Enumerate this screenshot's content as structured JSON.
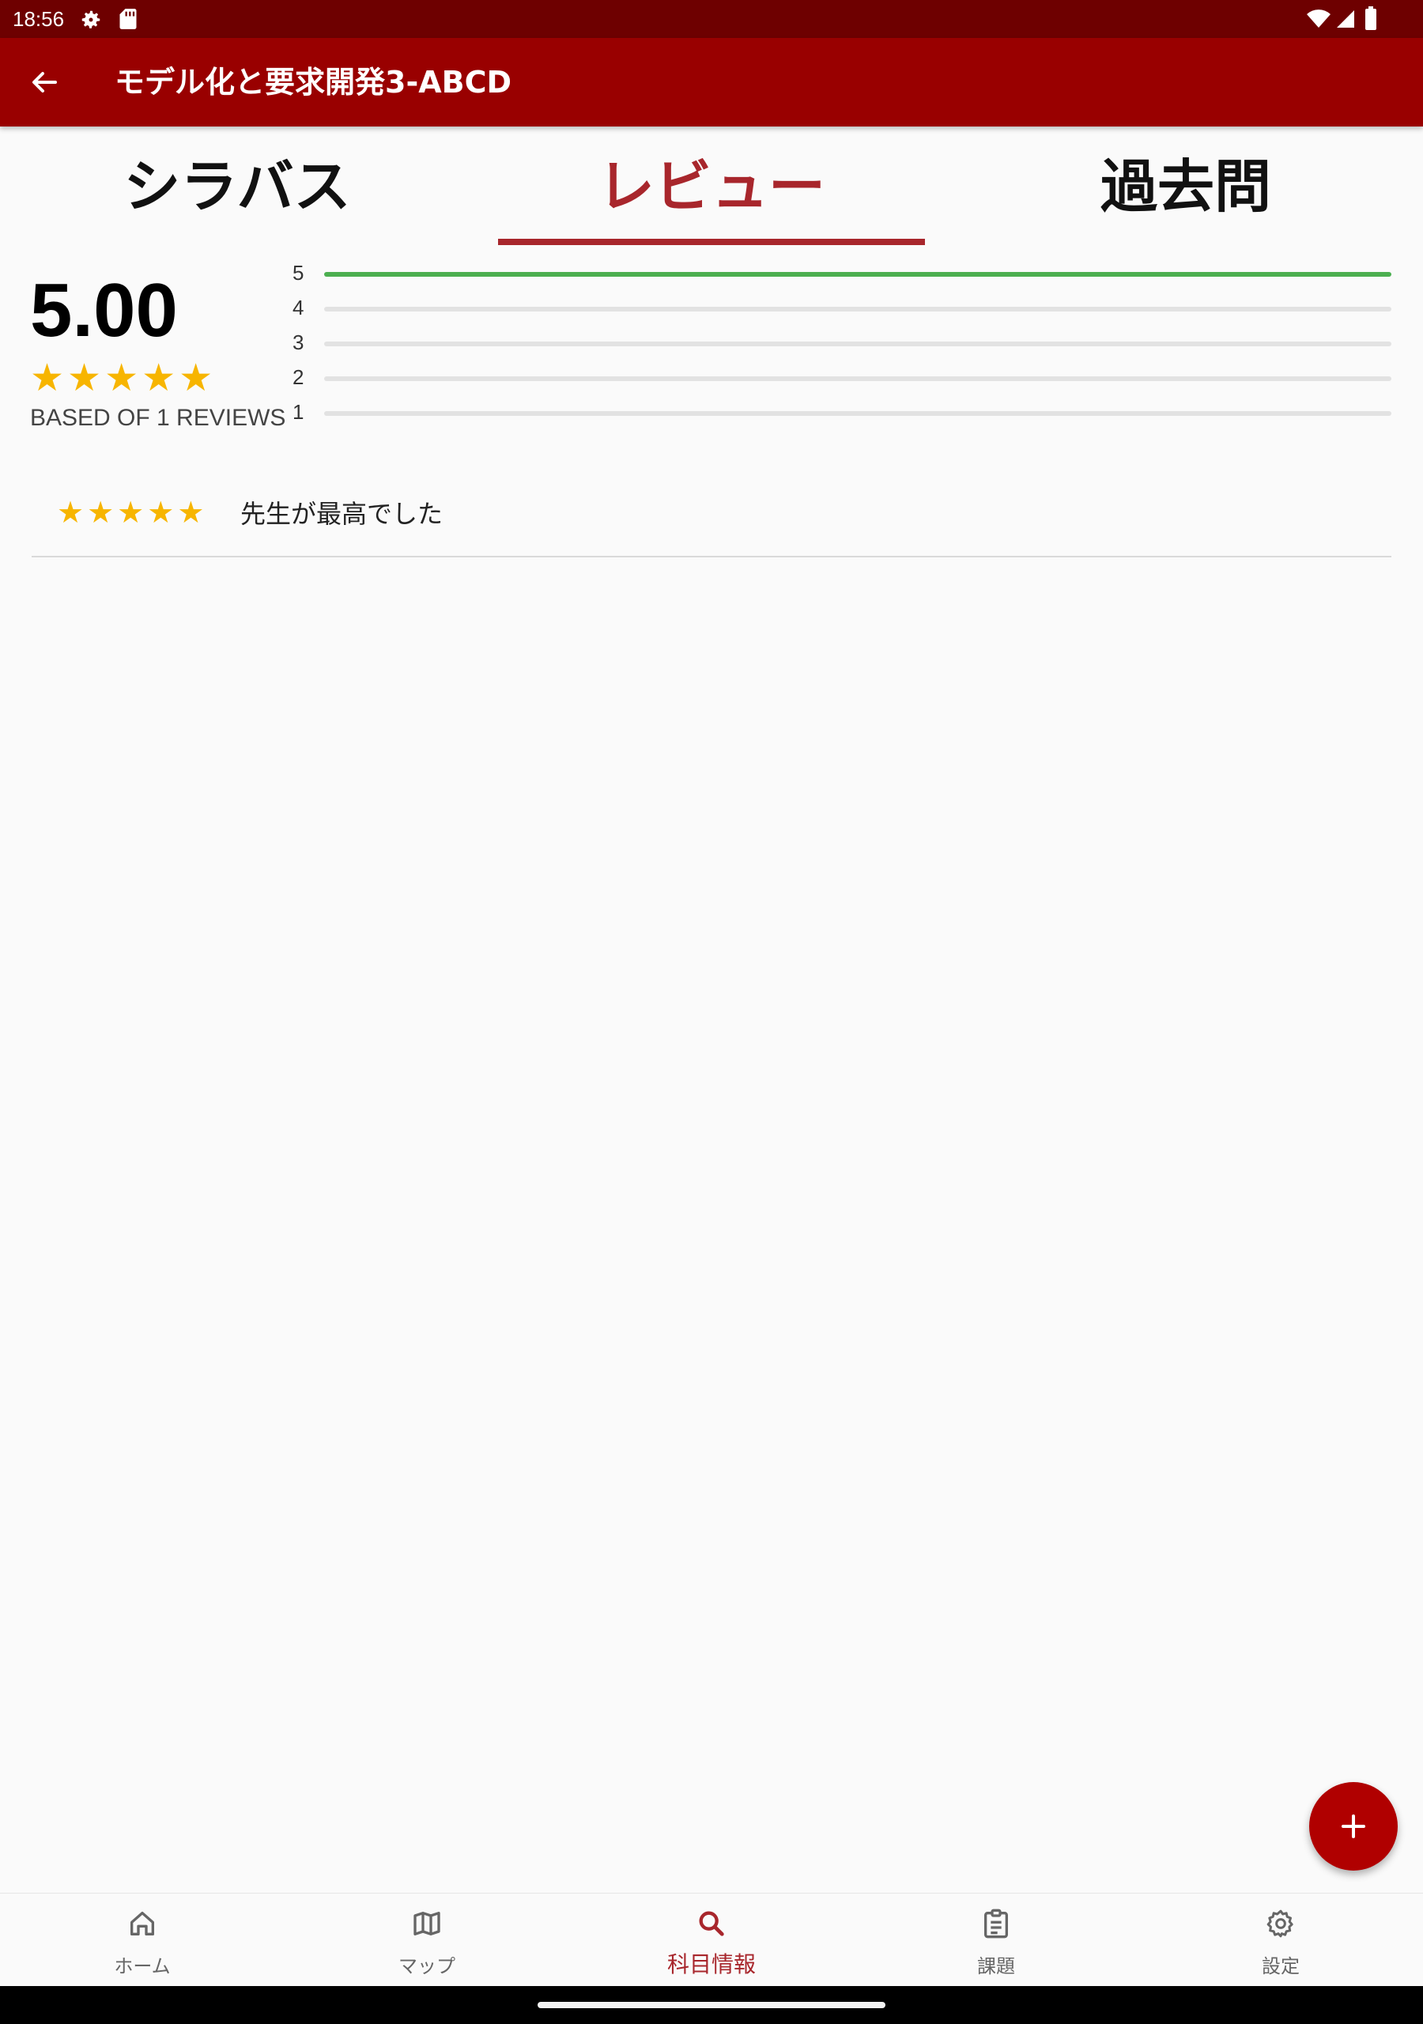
{
  "status_bar": {
    "time": "18:56",
    "icons": [
      "gear-icon",
      "sd-card-icon",
      "wifi-icon",
      "signal-icon",
      "battery-icon"
    ]
  },
  "app_bar": {
    "title": "モデル化と要求開発3-ABCD",
    "back_icon": "arrow-back-icon",
    "color": "#990000"
  },
  "tabs": [
    {
      "label": "シラバス",
      "selected": false
    },
    {
      "label": "レビュー",
      "selected": true
    },
    {
      "label": "過去問",
      "selected": false
    }
  ],
  "rating_summary": {
    "score": "5.00",
    "stars": 5,
    "count_text": "BASED OF 1 REVIEWS",
    "distribution": [
      {
        "label": "5",
        "fraction": 1.0
      },
      {
        "label": "4",
        "fraction": 0.0
      },
      {
        "label": "3",
        "fraction": 0.0
      },
      {
        "label": "2",
        "fraction": 0.0
      },
      {
        "label": "1",
        "fraction": 0.0
      }
    ],
    "bar_color": "#4caf50",
    "star_color": "#f7b500"
  },
  "reviews": [
    {
      "stars": 5,
      "text": "先生が最高でした"
    }
  ],
  "fab": {
    "icon": "plus-icon",
    "color": "#b00000"
  },
  "bottom_nav": [
    {
      "label": "ホーム",
      "icon": "home-icon",
      "active": false
    },
    {
      "label": "マップ",
      "icon": "map-icon",
      "active": false
    },
    {
      "label": "科目情報",
      "icon": "search-icon",
      "active": true
    },
    {
      "label": "課題",
      "icon": "clipboard-icon",
      "active": false
    },
    {
      "label": "設定",
      "icon": "gear-icon",
      "active": false
    }
  ],
  "accent_color": "#a8262c"
}
